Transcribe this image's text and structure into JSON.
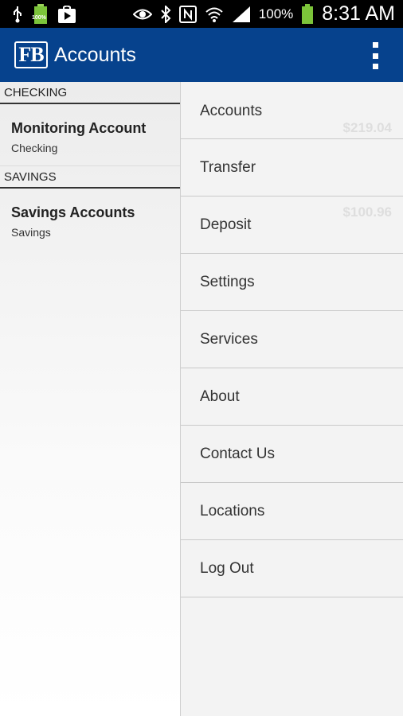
{
  "status_bar": {
    "battery_small_label": "100%",
    "battery_pct": "100%",
    "time": "8:31 AM",
    "icons": [
      "usb-icon",
      "battery-icon",
      "play-store-icon",
      "eye-icon",
      "bluetooth-icon",
      "nfc-icon",
      "wifi-icon",
      "signal-icon",
      "battery-icon"
    ]
  },
  "app_bar": {
    "logo_text": "FB",
    "title": "Accounts"
  },
  "accounts": {
    "sections": [
      {
        "header": "CHECKING",
        "items": [
          {
            "name": "Monitoring Account",
            "type": "Checking"
          }
        ]
      },
      {
        "header": "SAVINGS",
        "items": [
          {
            "name": "Savings Accounts",
            "type": "Savings"
          }
        ]
      }
    ],
    "ghost_amounts": [
      "$219.04",
      "$100.96"
    ]
  },
  "menu": {
    "items": [
      "Accounts",
      "Transfer",
      "Deposit",
      "Settings",
      "Services",
      "About",
      "Contact Us",
      "Locations",
      "Log Out"
    ]
  },
  "colors": {
    "app_bar": "#06428d",
    "status_bar": "#000000",
    "battery_green": "#7cc43a"
  }
}
